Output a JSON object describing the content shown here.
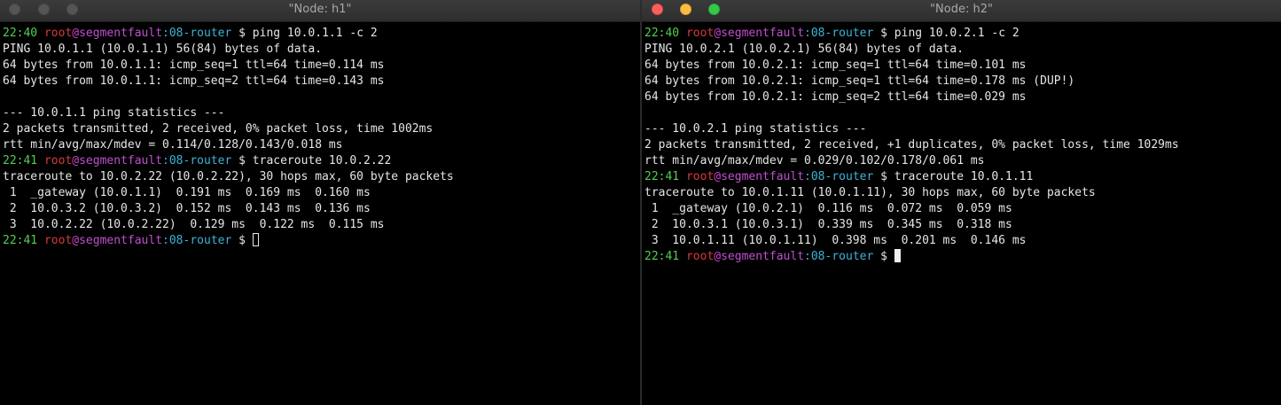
{
  "windows": [
    {
      "title": "\"Node: h1\"",
      "prompt": {
        "user": "root",
        "at": "@",
        "host": "segmentfault",
        "colon": ":",
        "dir": "08-router",
        "symbol": " $ "
      },
      "blocks": [
        {
          "time": "22:40",
          "command": "ping 10.0.1.1 -c 2",
          "output": [
            "PING 10.0.1.1 (10.0.1.1) 56(84) bytes of data.",
            "64 bytes from 10.0.1.1: icmp_seq=1 ttl=64 time=0.114 ms",
            "64 bytes from 10.0.1.1: icmp_seq=2 ttl=64 time=0.143 ms",
            "",
            "--- 10.0.1.1 ping statistics ---",
            "2 packets transmitted, 2 received, 0% packet loss, time 1002ms",
            "rtt min/avg/max/mdev = 0.114/0.128/0.143/0.018 ms"
          ]
        },
        {
          "time": "22:41",
          "command": "traceroute 10.0.2.22",
          "output": [
            "traceroute to 10.0.2.22 (10.0.2.22), 30 hops max, 60 byte packets",
            " 1  _gateway (10.0.1.1)  0.191 ms  0.169 ms  0.160 ms",
            " 2  10.0.3.2 (10.0.3.2)  0.152 ms  0.143 ms  0.136 ms",
            " 3  10.0.2.22 (10.0.2.22)  0.129 ms  0.122 ms  0.115 ms"
          ]
        }
      ],
      "final_prompt_time": "22:41"
    },
    {
      "title": "\"Node: h2\"",
      "prompt": {
        "user": "root",
        "at": "@",
        "host": "segmentfault",
        "colon": ":",
        "dir": "08-router",
        "symbol": " $ "
      },
      "blocks": [
        {
          "time": "22:40",
          "command": "ping 10.0.2.1 -c 2",
          "output": [
            "PING 10.0.2.1 (10.0.2.1) 56(84) bytes of data.",
            "64 bytes from 10.0.2.1: icmp_seq=1 ttl=64 time=0.101 ms",
            "64 bytes from 10.0.2.1: icmp_seq=1 ttl=64 time=0.178 ms (DUP!)",
            "64 bytes from 10.0.2.1: icmp_seq=2 ttl=64 time=0.029 ms",
            "",
            "--- 10.0.2.1 ping statistics ---",
            "2 packets transmitted, 2 received, +1 duplicates, 0% packet loss, time 1029ms",
            "rtt min/avg/max/mdev = 0.029/0.102/0.178/0.061 ms"
          ]
        },
        {
          "time": "22:41",
          "command": "traceroute 10.0.1.11",
          "output": [
            "traceroute to 10.0.1.11 (10.0.1.11), 30 hops max, 60 byte packets",
            " 1  _gateway (10.0.2.1)  0.116 ms  0.072 ms  0.059 ms",
            " 2  10.0.3.1 (10.0.3.1)  0.339 ms  0.345 ms  0.318 ms",
            " 3  10.0.1.11 (10.0.1.11)  0.398 ms  0.201 ms  0.146 ms"
          ]
        }
      ],
      "final_prompt_time": "22:41"
    }
  ]
}
